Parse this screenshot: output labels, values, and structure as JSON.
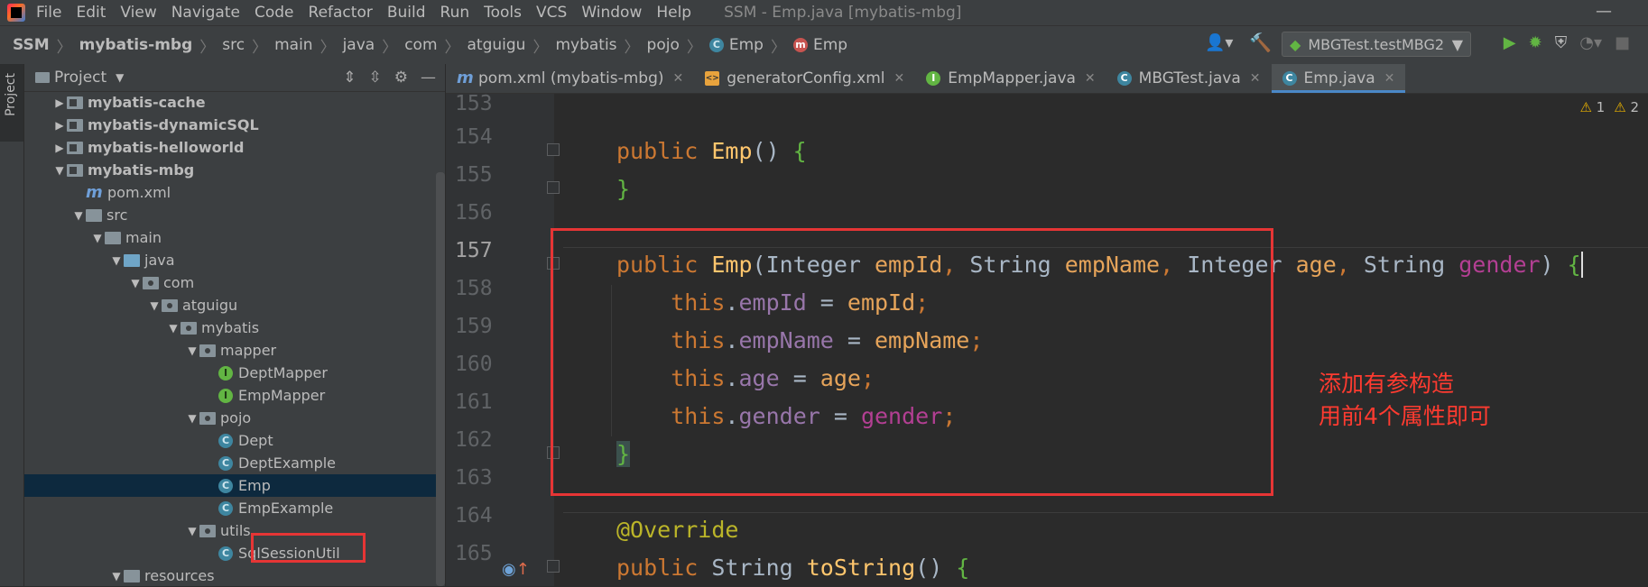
{
  "window": {
    "menu": [
      "File",
      "Edit",
      "View",
      "Navigate",
      "Code",
      "Refactor",
      "Build",
      "Run",
      "Tools",
      "VCS",
      "Window",
      "Help"
    ],
    "title": "SSM - Emp.java [mybatis-mbg]"
  },
  "breadcrumb": [
    "SSM",
    "mybatis-mbg",
    "src",
    "main",
    "java",
    "com",
    "atguigu",
    "mybatis",
    "pojo",
    "Emp",
    "Emp"
  ],
  "run_config": "MBGTest.testMBG2",
  "project_panel": {
    "title": "Project",
    "side_label": "Project",
    "tree": [
      {
        "label": "mybatis-cache",
        "indent": 1,
        "type": "module",
        "chev": "▶"
      },
      {
        "label": "mybatis-dynamicSQL",
        "indent": 1,
        "type": "module",
        "chev": "▶"
      },
      {
        "label": "mybatis-helloworld",
        "indent": 1,
        "type": "module",
        "chev": "▶"
      },
      {
        "label": "mybatis-mbg",
        "indent": 1,
        "type": "module",
        "chev": "▼"
      },
      {
        "label": "pom.xml",
        "indent": 2,
        "type": "maven"
      },
      {
        "label": "src",
        "indent": 2,
        "type": "folder",
        "chev": "▼"
      },
      {
        "label": "main",
        "indent": 3,
        "type": "folder",
        "chev": "▼"
      },
      {
        "label": "java",
        "indent": 4,
        "type": "srcfolder",
        "chev": "▼"
      },
      {
        "label": "com",
        "indent": 5,
        "type": "package",
        "chev": "▼"
      },
      {
        "label": "atguigu",
        "indent": 6,
        "type": "package",
        "chev": "▼"
      },
      {
        "label": "mybatis",
        "indent": 7,
        "type": "package",
        "chev": "▼"
      },
      {
        "label": "mapper",
        "indent": 8,
        "type": "package",
        "chev": "▼"
      },
      {
        "label": "DeptMapper",
        "indent": 9,
        "type": "interface"
      },
      {
        "label": "EmpMapper",
        "indent": 9,
        "type": "interface"
      },
      {
        "label": "pojo",
        "indent": 8,
        "type": "package",
        "chev": "▼"
      },
      {
        "label": "Dept",
        "indent": 9,
        "type": "class"
      },
      {
        "label": "DeptExample",
        "indent": 9,
        "type": "class"
      },
      {
        "label": "Emp",
        "indent": 9,
        "type": "class",
        "selected": true
      },
      {
        "label": "EmpExample",
        "indent": 9,
        "type": "class"
      },
      {
        "label": "utils",
        "indent": 8,
        "type": "package",
        "chev": "▼"
      },
      {
        "label": "SqlSessionUtil",
        "indent": 9,
        "type": "class"
      },
      {
        "label": "resources",
        "indent": 4,
        "type": "folder",
        "chev": "▼"
      }
    ]
  },
  "tabs": [
    {
      "label": "pom.xml (mybatis-mbg)",
      "icon": "m",
      "color": "#6f9fd8"
    },
    {
      "label": "generatorConfig.xml",
      "icon": "xml",
      "color": "#e8a33d"
    },
    {
      "label": "EmpMapper.java",
      "icon": "I",
      "color": "#62b543"
    },
    {
      "label": "MBGTest.java",
      "icon": "C",
      "color": "#3e86a0"
    },
    {
      "label": "Emp.java",
      "icon": "C",
      "color": "#3e86a0",
      "active": true
    }
  ],
  "editor": {
    "line_numbers": [
      "153",
      "154",
      "155",
      "156",
      "157",
      "158",
      "159",
      "160",
      "161",
      "162",
      "163",
      "164",
      "165"
    ],
    "warnings": [
      "1",
      "2"
    ],
    "annotation_note": [
      "添加有参构造",
      "用前4个属性即可"
    ]
  }
}
